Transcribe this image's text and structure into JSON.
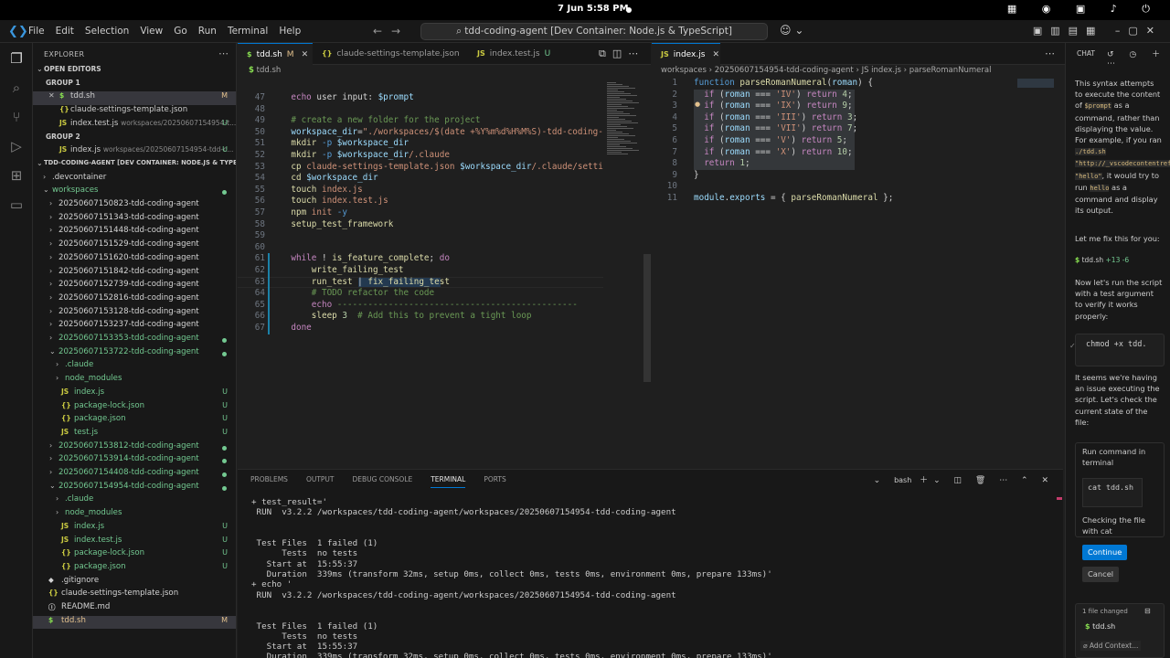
{
  "os": {
    "clock": "7 Jun  5:58 PM"
  },
  "window": {
    "menus": [
      "File",
      "Edit",
      "Selection",
      "View",
      "Go",
      "Run",
      "Terminal",
      "Help"
    ],
    "command_center": "tdd-coding-agent [Dev Container: Node.js & TypeScript]"
  },
  "explorer": {
    "title": "EXPLORER",
    "open_editors_label": "OPEN EDITORS",
    "group1": "GROUP 1",
    "group2": "GROUP 2",
    "workspace_label": "TDD-CODING-AGENT [DEV CONTAINER: NODE.JS & TYPESCRIPT]",
    "open_g1": [
      {
        "icon": "$",
        "name": "tdd.sh",
        "sub": "",
        "badge": "M"
      },
      {
        "icon": "{}",
        "name": "claude-settings-template.json",
        "sub": "",
        "badge": ""
      },
      {
        "icon": "JS",
        "name": "index.test.js",
        "sub": "workspaces/20250607154954-t...",
        "badge": "U"
      }
    ],
    "open_g2": [
      {
        "icon": "JS",
        "name": "index.js",
        "sub": "workspaces/20250607154954-tdd-c...",
        "badge": "U"
      }
    ],
    "tree": [
      {
        "depth": 1,
        "chev": "›",
        "icon": "",
        "name": ".devcontainer",
        "badge": "",
        "color": "pl"
      },
      {
        "depth": 1,
        "chev": "⌄",
        "icon": "",
        "name": "workspaces",
        "badge": "dot",
        "color": "green"
      },
      {
        "depth": 2,
        "chev": "›",
        "icon": "",
        "name": "20250607150823-tdd-coding-agent",
        "badge": "",
        "color": "pl"
      },
      {
        "depth": 2,
        "chev": "›",
        "icon": "",
        "name": "20250607151343-tdd-coding-agent",
        "badge": "",
        "color": "pl"
      },
      {
        "depth": 2,
        "chev": "›",
        "icon": "",
        "name": "20250607151448-tdd-coding-agent",
        "badge": "",
        "color": "pl"
      },
      {
        "depth": 2,
        "chev": "›",
        "icon": "",
        "name": "20250607151529-tdd-coding-agent",
        "badge": "",
        "color": "pl"
      },
      {
        "depth": 2,
        "chev": "›",
        "icon": "",
        "name": "20250607151620-tdd-coding-agent",
        "badge": "",
        "color": "pl"
      },
      {
        "depth": 2,
        "chev": "›",
        "icon": "",
        "name": "20250607151842-tdd-coding-agent",
        "badge": "",
        "color": "pl"
      },
      {
        "depth": 2,
        "chev": "›",
        "icon": "",
        "name": "20250607152739-tdd-coding-agent",
        "badge": "",
        "color": "pl"
      },
      {
        "depth": 2,
        "chev": "›",
        "icon": "",
        "name": "20250607152816-tdd-coding-agent",
        "badge": "",
        "color": "pl"
      },
      {
        "depth": 2,
        "chev": "›",
        "icon": "",
        "name": "20250607153128-tdd-coding-agent",
        "badge": "",
        "color": "pl"
      },
      {
        "depth": 2,
        "chev": "›",
        "icon": "",
        "name": "20250607153237-tdd-coding-agent",
        "badge": "",
        "color": "pl"
      },
      {
        "depth": 2,
        "chev": "›",
        "icon": "",
        "name": "20250607153353-tdd-coding-agent",
        "badge": "dot",
        "color": "green"
      },
      {
        "depth": 2,
        "chev": "⌄",
        "icon": "",
        "name": "20250607153722-tdd-coding-agent",
        "badge": "dot",
        "color": "green"
      },
      {
        "depth": 3,
        "chev": "›",
        "icon": "",
        "name": ".claude",
        "badge": "",
        "color": "green"
      },
      {
        "depth": 3,
        "chev": "›",
        "icon": "",
        "name": "node_modules",
        "badge": "",
        "color": "green"
      },
      {
        "depth": 3,
        "chev": "",
        "icon": "JS",
        "name": "index.js",
        "badge": "U",
        "color": "green"
      },
      {
        "depth": 3,
        "chev": "",
        "icon": "{}",
        "name": "package-lock.json",
        "badge": "U",
        "color": "green"
      },
      {
        "depth": 3,
        "chev": "",
        "icon": "{}",
        "name": "package.json",
        "badge": "U",
        "color": "green"
      },
      {
        "depth": 3,
        "chev": "",
        "icon": "JS",
        "name": "test.js",
        "badge": "U",
        "color": "green"
      },
      {
        "depth": 2,
        "chev": "›",
        "icon": "",
        "name": "20250607153812-tdd-coding-agent",
        "badge": "dot",
        "color": "green"
      },
      {
        "depth": 2,
        "chev": "›",
        "icon": "",
        "name": "20250607153914-tdd-coding-agent",
        "badge": "dot",
        "color": "green"
      },
      {
        "depth": 2,
        "chev": "›",
        "icon": "",
        "name": "20250607154408-tdd-coding-agent",
        "badge": "dot",
        "color": "green"
      },
      {
        "depth": 2,
        "chev": "⌄",
        "icon": "",
        "name": "20250607154954-tdd-coding-agent",
        "badge": "dot",
        "color": "green"
      },
      {
        "depth": 3,
        "chev": "›",
        "icon": "",
        "name": ".claude",
        "badge": "",
        "color": "green"
      },
      {
        "depth": 3,
        "chev": "›",
        "icon": "",
        "name": "node_modules",
        "badge": "",
        "color": "green"
      },
      {
        "depth": 3,
        "chev": "",
        "icon": "JS",
        "name": "index.js",
        "badge": "U",
        "color": "green"
      },
      {
        "depth": 3,
        "chev": "",
        "icon": "JS",
        "name": "index.test.js",
        "badge": "U",
        "color": "green"
      },
      {
        "depth": 3,
        "chev": "",
        "icon": "{}",
        "name": "package-lock.json",
        "badge": "U",
        "color": "green"
      },
      {
        "depth": 3,
        "chev": "",
        "icon": "{}",
        "name": "package.json",
        "badge": "U",
        "color": "green"
      },
      {
        "depth": 1,
        "chev": "",
        "icon": "◆",
        "name": ".gitignore",
        "badge": "",
        "color": "pl"
      },
      {
        "depth": 1,
        "chev": "",
        "icon": "{}",
        "name": "claude-settings-template.json",
        "badge": "",
        "color": "pl"
      },
      {
        "depth": 1,
        "chev": "",
        "icon": "ⓘ",
        "name": "README.md",
        "badge": "",
        "color": "pl"
      },
      {
        "depth": 1,
        "chev": "",
        "icon": "$",
        "name": "tdd.sh",
        "badge": "M",
        "color": "mod"
      }
    ]
  },
  "editor_left": {
    "tabs": [
      {
        "icon": "$",
        "label": "tdd.sh",
        "state": "M",
        "active": true
      },
      {
        "icon": "{}",
        "label": "claude-settings-template.json",
        "state": "",
        "active": false
      },
      {
        "icon": "JS",
        "label": "index.test.js",
        "state": "U",
        "active": false
      }
    ],
    "breadcrumb": "$ tdd.sh",
    "line_numbers": [
      "47",
      "48",
      "49",
      "50",
      "51",
      "52",
      "53",
      "54",
      "55",
      "56",
      "57",
      "58",
      "59",
      "60",
      "61",
      "62",
      "63",
      "64",
      "65",
      "66",
      "67"
    ],
    "lines": [
      [
        [
          "pl",
          "    "
        ],
        [
          "kw",
          "echo "
        ],
        [
          "pl",
          "user input: "
        ],
        [
          "vr",
          "$prompt"
        ]
      ],
      [
        [
          "pl",
          ""
        ]
      ],
      [
        [
          "cm",
          "    # create a new folder for the project"
        ]
      ],
      [
        [
          "vr",
          "    workspace_dir"
        ],
        [
          "pl",
          "="
        ],
        [
          "st",
          "\"./workspaces/$(date +%Y%m%d%H%M%S)-tdd-coding-a"
        ]
      ],
      [
        [
          "fn",
          "    mkdir "
        ],
        [
          "bl",
          "-p "
        ],
        [
          "vr",
          "$workspace_dir"
        ]
      ],
      [
        [
          "fn",
          "    mkdir "
        ],
        [
          "bl",
          "-p "
        ],
        [
          "vr",
          "$workspace_dir"
        ],
        [
          "st",
          "/.claude"
        ]
      ],
      [
        [
          "fn",
          "    cp "
        ],
        [
          "st",
          "claude-settings-template.json "
        ],
        [
          "vr",
          "$workspace_dir"
        ],
        [
          "st",
          "/.claude/settin"
        ]
      ],
      [
        [
          "fn",
          "    cd "
        ],
        [
          "vr",
          "$workspace_dir"
        ]
      ],
      [
        [
          "fn",
          "    touch "
        ],
        [
          "st",
          "index.js"
        ]
      ],
      [
        [
          "fn",
          "    touch "
        ],
        [
          "st",
          "index.test.js"
        ]
      ],
      [
        [
          "fn",
          "    npm "
        ],
        [
          "st",
          "init "
        ],
        [
          "bl",
          "-y"
        ]
      ],
      [
        [
          "fn",
          "    setup_test_framework"
        ]
      ],
      [
        [
          "pl",
          ""
        ]
      ],
      [
        [
          "pl",
          ""
        ]
      ],
      [
        [
          "kw",
          "    while "
        ],
        [
          "pl",
          "! "
        ],
        [
          "fn",
          "is_feature_complete"
        ],
        [
          "pl",
          "; "
        ],
        [
          "kw",
          "do"
        ]
      ],
      [
        [
          "fn",
          "        write_failing_test"
        ]
      ],
      [
        [
          "fn",
          "        run_test "
        ],
        [
          "pl",
          "| "
        ],
        [
          "fn",
          "fix_failing_test"
        ]
      ],
      [
        [
          "cm",
          "        # TODO refactor the code"
        ]
      ],
      [
        [
          "kw",
          "        echo "
        ],
        [
          "cm",
          "-----------------------------------------------"
        ]
      ],
      [
        [
          "fn",
          "        sleep "
        ],
        [
          "nm",
          "3 "
        ],
        [
          "cm",
          " # Add this to prevent a tight loop"
        ]
      ],
      [
        [
          "kw",
          "    done"
        ]
      ]
    ]
  },
  "editor_right": {
    "tabs": [
      {
        "icon": "JS",
        "label": "index.js",
        "state": "",
        "active": true
      }
    ],
    "breadcrumb": [
      "workspaces",
      "20250607154954-tdd-coding-agent",
      "JS index.js",
      "parseRomanNumeral"
    ],
    "line_numbers": [
      "1",
      "2",
      "3",
      "4",
      "5",
      "6",
      "7",
      "8",
      "9",
      "10",
      "11"
    ],
    "lines": [
      [
        [
          "bl",
          "function "
        ],
        [
          "fn",
          "parseRomanNumeral"
        ],
        [
          "pl",
          "("
        ],
        [
          "vr",
          "roman"
        ],
        [
          "pl",
          ") {"
        ]
      ],
      [
        [
          "kw",
          "  if "
        ],
        [
          "pl",
          "("
        ],
        [
          "vr",
          "roman "
        ],
        [
          "pl",
          "=== "
        ],
        [
          "st",
          "'IV'"
        ],
        [
          "pl",
          ") "
        ],
        [
          "kw",
          "return "
        ],
        [
          "nm",
          "4"
        ],
        [
          "pl",
          ";"
        ]
      ],
      [
        [
          "kw",
          "  if "
        ],
        [
          "pl",
          "("
        ],
        [
          "vr",
          "roman "
        ],
        [
          "pl",
          "=== "
        ],
        [
          "st",
          "'IX'"
        ],
        [
          "pl",
          ") "
        ],
        [
          "kw",
          "return "
        ],
        [
          "nm",
          "9"
        ],
        [
          "pl",
          ";"
        ]
      ],
      [
        [
          "kw",
          "  if "
        ],
        [
          "pl",
          "("
        ],
        [
          "vr",
          "roman "
        ],
        [
          "pl",
          "=== "
        ],
        [
          "st",
          "'III'"
        ],
        [
          "pl",
          ") "
        ],
        [
          "kw",
          "return "
        ],
        [
          "nm",
          "3"
        ],
        [
          "pl",
          ";"
        ]
      ],
      [
        [
          "kw",
          "  if "
        ],
        [
          "pl",
          "("
        ],
        [
          "vr",
          "roman "
        ],
        [
          "pl",
          "=== "
        ],
        [
          "st",
          "'VII'"
        ],
        [
          "pl",
          ") "
        ],
        [
          "kw",
          "return "
        ],
        [
          "nm",
          "7"
        ],
        [
          "pl",
          ";"
        ]
      ],
      [
        [
          "kw",
          "  if "
        ],
        [
          "pl",
          "("
        ],
        [
          "vr",
          "roman "
        ],
        [
          "pl",
          "=== "
        ],
        [
          "st",
          "'V'"
        ],
        [
          "pl",
          ") "
        ],
        [
          "kw",
          "return "
        ],
        [
          "nm",
          "5"
        ],
        [
          "pl",
          ";"
        ]
      ],
      [
        [
          "kw",
          "  if "
        ],
        [
          "pl",
          "("
        ],
        [
          "vr",
          "roman "
        ],
        [
          "pl",
          "=== "
        ],
        [
          "st",
          "'X'"
        ],
        [
          "pl",
          ") "
        ],
        [
          "kw",
          "return "
        ],
        [
          "nm",
          "10"
        ],
        [
          "pl",
          ";"
        ]
      ],
      [
        [
          "kw",
          "  return "
        ],
        [
          "nm",
          "1"
        ],
        [
          "pl",
          ";"
        ]
      ],
      [
        [
          "pl",
          "}"
        ]
      ],
      [
        [
          "pl",
          ""
        ]
      ],
      [
        [
          "vr",
          "module"
        ],
        [
          "pl",
          "."
        ],
        [
          "vr",
          "exports "
        ],
        [
          "pl",
          "= { "
        ],
        [
          "fn",
          "parseRomanNumeral "
        ],
        [
          "pl",
          "};"
        ]
      ]
    ]
  },
  "panel": {
    "tabs": [
      "PROBLEMS",
      "OUTPUT",
      "DEBUG CONSOLE",
      "TERMINAL",
      "PORTS"
    ],
    "active_tab": "TERMINAL",
    "shell": "bash",
    "terminal_lines": [
      "+ test_result='",
      " RUN  v3.2.2 /workspaces/tdd-coding-agent/workspaces/20250607154954-tdd-coding-agent",
      "",
      "",
      " Test Files  1 failed (1)",
      "      Tests  no tests",
      "   Start at  15:55:37",
      "   Duration  339ms (transform 32ms, setup 0ms, collect 0ms, tests 0ms, environment 0ms, prepare 133ms)'",
      "+ echo '",
      " RUN  v3.2.2 /workspaces/tdd-coding-agent/workspaces/20250607154954-tdd-coding-agent",
      "",
      "",
      " Test Files  1 failed (1)",
      "      Tests  no tests",
      "   Start at  15:55:37",
      "   Duration  339ms (transform 32ms, setup 0ms, collect 0ms, tests 0ms, environment 0ms, prepare 133ms)'"
    ]
  },
  "chat": {
    "title": "CHAT",
    "p1_a": "This syntax attempts to execute the content of",
    "p1_code1": "$prompt",
    "p1_b": "as a command, rather than displaying the value. For example, if you ran",
    "p1_code2": "./tdd.sh \"http://_vscodecontentref_/0) \"hello\"",
    "p1_c": ", it would try to run",
    "p1_code3": "hello",
    "p1_d": "as a command and display its output.",
    "p2": "Let me fix this for you:",
    "file_chip": "tdd.sh",
    "file_chip_diff": "+13 -6",
    "p3": "Now let's run the script with a test argument to verify it works properly:",
    "cmd1": "chmod +x tdd.",
    "p4": "It seems we're having an issue executing the script. Let's check the current state of the file:",
    "run_title": "Run command in terminal",
    "cmd2": "cat tdd.sh",
    "cmd2_note": "Checking the file with cat",
    "continue": "Continue",
    "cancel": "Cancel",
    "files_changed": "1 file changed",
    "changed_file": "tdd.sh",
    "add_context": "Add Context..."
  },
  "colors": {
    "accent": "#0078d4",
    "untracked": "#73c991",
    "modified": "#e2c08d"
  }
}
